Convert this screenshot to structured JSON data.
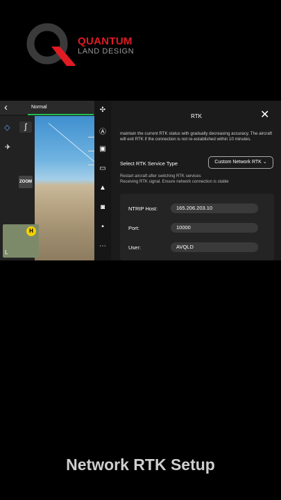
{
  "logo": {
    "line1": "QUANTUM",
    "line2": "LAND DESIGN",
    "brand_color": "#e01b22"
  },
  "app": {
    "back_icon": "chevron-left-icon",
    "mode": "Normal",
    "zoom_label": "ZOOM",
    "home_marker": "H",
    "minimap_label": "L",
    "side_icons": [
      "drone-icon",
      "a-circle-icon",
      "rc-icon",
      "hd-icon",
      "signal-icon",
      "camera-icon",
      "rtk-icon",
      "more-icon"
    ]
  },
  "panel": {
    "title": "RTK",
    "warning": "maintain the current RTK status with gradually decreasing accuracy. The aircraft will exit RTK if the connection is not re-established within 10 minutes.",
    "service_label": "Select RTK Service Type",
    "service_value": "Custom Network RTK",
    "note1": "Restart aircraft after switching RTK services",
    "note2": "Receiving RTK signal. Ensure network connection is stable",
    "fields": [
      {
        "label": "NTRIP Host:",
        "value": "165.206.203.10"
      },
      {
        "label": "Port:",
        "value": "10000"
      },
      {
        "label": "User:",
        "value": "AVQLD"
      }
    ]
  },
  "caption": "Network RTK Setup"
}
